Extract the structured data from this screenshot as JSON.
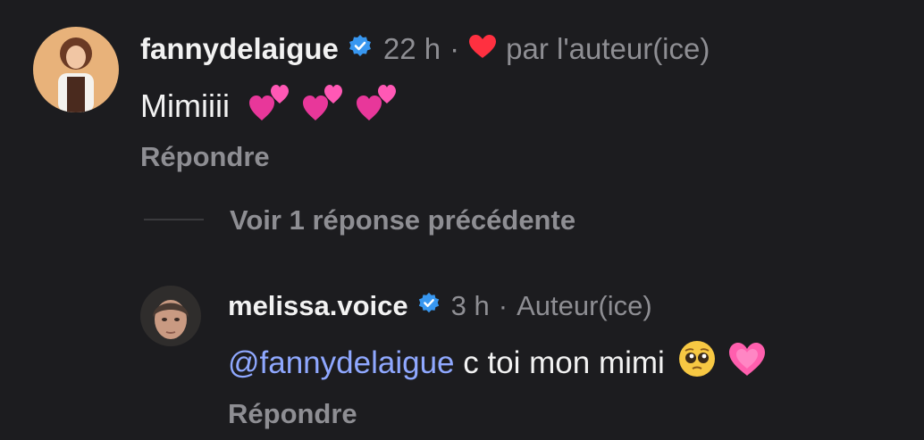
{
  "comment": {
    "username": "fannydelaigue",
    "time": "22 h",
    "separator": "·",
    "liked_by_author_text": "par l'auteur(ice)",
    "text": "Mimiiii",
    "emojis": [
      "two-hearts",
      "two-hearts",
      "two-hearts"
    ],
    "reply_label": "Répondre"
  },
  "view_previous": {
    "label": "Voir 1 réponse précédente"
  },
  "reply": {
    "username": "melissa.voice",
    "time": "3 h",
    "separator": "·",
    "author_badge": "Auteur(ice)",
    "mention": "@fannydelaigue",
    "text": " c toi mon mimi",
    "emojis": [
      "pleading-face",
      "growing-heart"
    ],
    "reply_label": "Répondre"
  },
  "colors": {
    "background": "#1c1c1f",
    "verified": "#3897f0",
    "like_heart": "#ff3040",
    "mention": "#8fa8ff",
    "muted": "#8e8e93"
  }
}
